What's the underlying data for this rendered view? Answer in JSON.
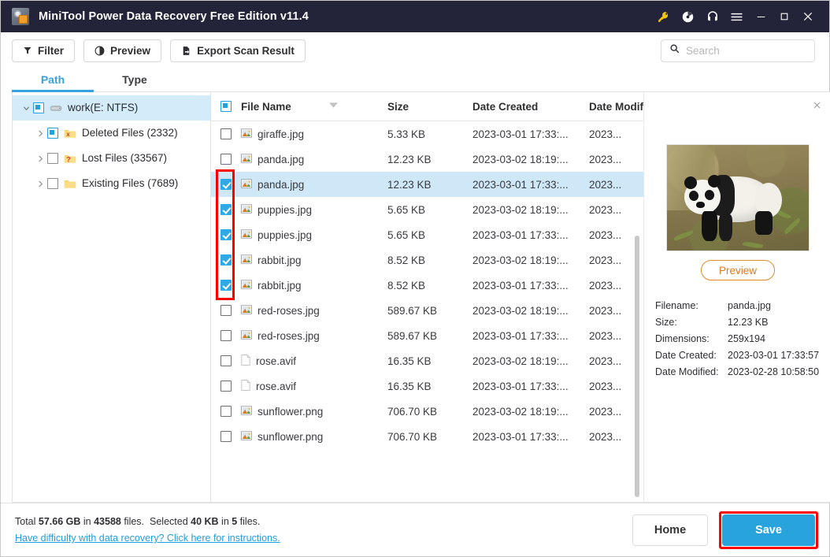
{
  "titlebar": {
    "app_title": "MiniTool Power Data Recovery Free Edition v11.4",
    "logo_icon": "minitool-logo-icon",
    "icons": [
      {
        "name": "license-key-icon",
        "label": "Key"
      },
      {
        "name": "disc-icon",
        "label": "Bootable Media"
      },
      {
        "name": "headset-icon",
        "label": "Support"
      },
      {
        "name": "hamburger-menu-icon",
        "label": "Menu"
      }
    ],
    "window_controls": [
      {
        "name": "minimize-button",
        "label": "Minimize"
      },
      {
        "name": "maximize-button",
        "label": "Maximize"
      },
      {
        "name": "close-button",
        "label": "Close"
      }
    ]
  },
  "toolbar": {
    "filter_label": "Filter",
    "preview_label": "Preview",
    "export_label": "Export Scan Result",
    "search_placeholder": "Search",
    "search_value": ""
  },
  "tabs": [
    {
      "label": "Path",
      "active": true
    },
    {
      "label": "Type",
      "active": false
    }
  ],
  "sidebar": {
    "items": [
      {
        "label": "work(E: NTFS)",
        "check": "partial",
        "icon": "drive-icon",
        "expanded": true,
        "level": 0
      },
      {
        "label": "Deleted Files (2332)",
        "check": "partial",
        "icon": "folder-deleted-icon",
        "expanded": false,
        "level": 1
      },
      {
        "label": "Lost Files (33567)",
        "check": "unchecked",
        "icon": "folder-lost-icon",
        "expanded": false,
        "level": 1
      },
      {
        "label": "Existing Files (7689)",
        "check": "unchecked",
        "icon": "folder-icon",
        "expanded": false,
        "level": 1
      }
    ]
  },
  "filelist": {
    "header_check": "partial",
    "columns": [
      "File Name",
      "Size",
      "Date Created",
      "Date Modif"
    ],
    "sort_icon": "sort-descending-icon",
    "rows": [
      {
        "name": "giraffe.jpg",
        "size": "5.33 KB",
        "created": "2023-03-01 17:33:...",
        "modified": "2023...",
        "checked": false,
        "selected": false,
        "icon": "image-file-icon"
      },
      {
        "name": "panda.jpg",
        "size": "12.23 KB",
        "created": "2023-03-02 18:19:...",
        "modified": "2023...",
        "checked": false,
        "selected": false,
        "icon": "image-file-icon"
      },
      {
        "name": "panda.jpg",
        "size": "12.23 KB",
        "created": "2023-03-01 17:33:...",
        "modified": "2023...",
        "checked": true,
        "selected": true,
        "icon": "image-file-icon"
      },
      {
        "name": "puppies.jpg",
        "size": "5.65 KB",
        "created": "2023-03-02 18:19:...",
        "modified": "2023...",
        "checked": true,
        "selected": false,
        "icon": "image-file-icon"
      },
      {
        "name": "puppies.jpg",
        "size": "5.65 KB",
        "created": "2023-03-01 17:33:...",
        "modified": "2023...",
        "checked": true,
        "selected": false,
        "icon": "image-file-icon"
      },
      {
        "name": "rabbit.jpg",
        "size": "8.52 KB",
        "created": "2023-03-02 18:19:...",
        "modified": "2023...",
        "checked": true,
        "selected": false,
        "icon": "image-file-icon"
      },
      {
        "name": "rabbit.jpg",
        "size": "8.52 KB",
        "created": "2023-03-01 17:33:...",
        "modified": "2023...",
        "checked": true,
        "selected": false,
        "icon": "image-file-icon"
      },
      {
        "name": "red-roses.jpg",
        "size": "589.67 KB",
        "created": "2023-03-02 18:19:...",
        "modified": "2023...",
        "checked": false,
        "selected": false,
        "icon": "image-file-icon"
      },
      {
        "name": "red-roses.jpg",
        "size": "589.67 KB",
        "created": "2023-03-01 17:33:...",
        "modified": "2023...",
        "checked": false,
        "selected": false,
        "icon": "image-file-icon"
      },
      {
        "name": "rose.avif",
        "size": "16.35 KB",
        "created": "2023-03-02 18:19:...",
        "modified": "2023...",
        "checked": false,
        "selected": false,
        "icon": "generic-file-icon"
      },
      {
        "name": "rose.avif",
        "size": "16.35 KB",
        "created": "2023-03-01 17:33:...",
        "modified": "2023...",
        "checked": false,
        "selected": false,
        "icon": "generic-file-icon"
      },
      {
        "name": "sunflower.png",
        "size": "706.70 KB",
        "created": "2023-03-02 18:19:...",
        "modified": "2023...",
        "checked": false,
        "selected": false,
        "icon": "image-file-icon"
      },
      {
        "name": "sunflower.png",
        "size": "706.70 KB",
        "created": "2023-03-01 17:33:...",
        "modified": "2023...",
        "checked": false,
        "selected": false,
        "icon": "image-file-icon"
      }
    ]
  },
  "preview": {
    "close_icon": "close-icon",
    "thumbnail_alt": "panda-photo",
    "preview_button": "Preview",
    "meta": [
      {
        "key": "Filename:",
        "value": "panda.jpg"
      },
      {
        "key": "Size:",
        "value": "12.23 KB"
      },
      {
        "key": "Dimensions:",
        "value": "259x194"
      },
      {
        "key": "Date Created:",
        "value": "2023-03-01 17:33:57"
      },
      {
        "key": "Date Modified:",
        "value": "2023-02-28 10:58:50"
      }
    ]
  },
  "footer": {
    "total_prefix": "Total ",
    "total_size": "57.66 GB",
    "total_mid": " in ",
    "total_count": "43588",
    "total_suffix": " files.",
    "selected_prefix": "Selected ",
    "selected_size": "40 KB",
    "selected_mid": " in ",
    "selected_count": "5",
    "selected_suffix": " files.",
    "help_link": "Have difficulty with data recovery? Click here for instructions.",
    "home_label": "Home",
    "save_label": "Save"
  },
  "colors": {
    "titlebar_bg": "#232339",
    "accent_blue": "#35a3e0",
    "save_blue": "#29a3dc",
    "selection_blue": "#cfe8f8",
    "annotation_red": "#ff0000",
    "preview_orange": "#e0781f",
    "key_gold": "#f2c410"
  }
}
